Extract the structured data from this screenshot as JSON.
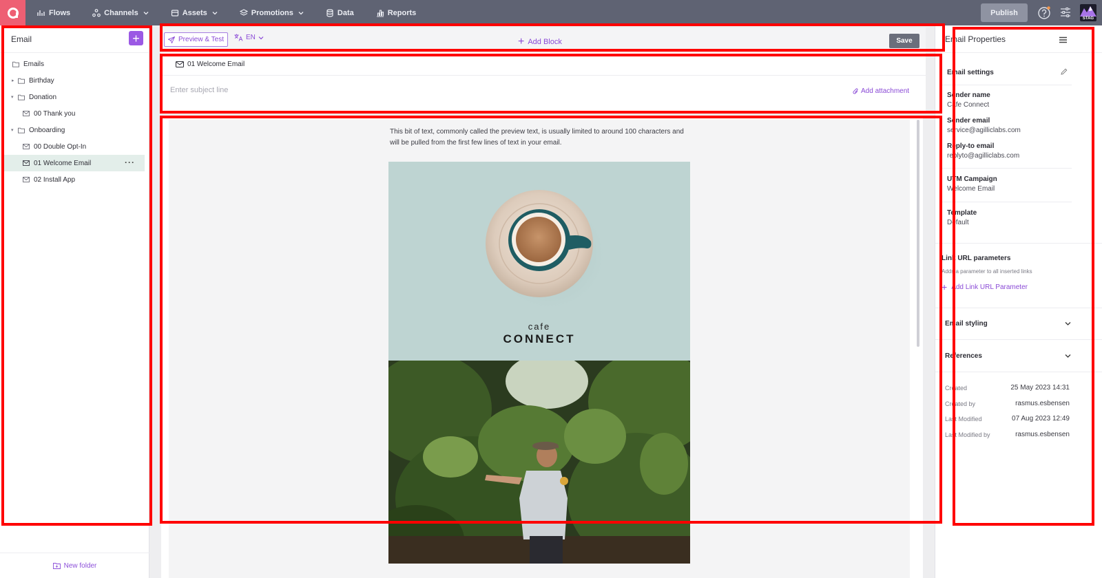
{
  "topbar": {
    "nav": [
      {
        "label": "Flows",
        "icon": "flows-icon",
        "dropdown": false
      },
      {
        "label": "Channels",
        "icon": "channels-icon",
        "dropdown": true
      },
      {
        "label": "Assets",
        "icon": "assets-icon",
        "dropdown": true
      },
      {
        "label": "Promotions",
        "icon": "promotions-icon",
        "dropdown": true
      },
      {
        "label": "Data",
        "icon": "data-icon",
        "dropdown": false
      },
      {
        "label": "Reports",
        "icon": "reports-icon",
        "dropdown": false
      }
    ],
    "publish_label": "Publish",
    "env_badge": "STAG"
  },
  "left_panel": {
    "title": "Email",
    "tree": [
      {
        "label": "Emails",
        "type": "folder",
        "level": 0,
        "expandable": false
      },
      {
        "label": "Birthday",
        "type": "folder",
        "level": 0,
        "expandable": true,
        "expanded": false
      },
      {
        "label": "Donation",
        "type": "folder",
        "level": 0,
        "expandable": true,
        "expanded": true
      },
      {
        "label": "00 Thank you",
        "type": "email",
        "level": 1
      },
      {
        "label": "Onboarding",
        "type": "folder",
        "level": 0,
        "expandable": true,
        "expanded": true
      },
      {
        "label": "00 Double Opt-In",
        "type": "email",
        "level": 1
      },
      {
        "label": "01 Welcome Email",
        "type": "email",
        "level": 1,
        "selected": true
      },
      {
        "label": "02 Install App",
        "type": "email",
        "level": 1
      }
    ],
    "new_folder_label": "New folder"
  },
  "toolbar": {
    "preview_label": "Preview & Test",
    "language": "EN",
    "add_block_label": "Add Block",
    "save_label": "Save"
  },
  "subject": {
    "email_name": "01 Welcome Email",
    "subject_placeholder": "Enter subject line",
    "attachment_label": "Add attachment"
  },
  "canvas": {
    "preheader": "This bit of text, commonly called the preview text, is usually limited to around 100 characters and will be pulled from the first few lines of text in your email.",
    "brand_small": "cafe",
    "brand_big": "CONNECT"
  },
  "properties": {
    "title": "Email Properties",
    "settings_label": "Email settings",
    "sender_name_label": "Sender name",
    "sender_name": "Cafe Connect",
    "sender_email_label": "Sender email",
    "sender_email": "service@agilliclabs.com",
    "reply_to_label": "Reply-to email",
    "reply_to": "replyto@agilliclabs.com",
    "utm_label": "UTM Campaign",
    "utm": "Welcome Email",
    "template_label": "Template",
    "template": "Default",
    "link_params_title": "Link URL parameters",
    "link_params_desc": "Adds a parameter to all inserted links",
    "add_link_param_label": "Add Link URL Parameter",
    "styling_label": "Email styling",
    "references_label": "References",
    "meta": [
      {
        "label": "Created",
        "value": "25 May 2023 14:31"
      },
      {
        "label": "Created by",
        "value": "rasmus.esbensen"
      },
      {
        "label": "Last Modified",
        "value": "07 Aug 2023 12:49"
      },
      {
        "label": "Last Modified by",
        "value": "rasmus.esbensen"
      }
    ]
  },
  "colors": {
    "topbar": "#5f6373",
    "logo": "#ee5f73",
    "accent": "#8a4ad6",
    "selected_row": "#e3eeea",
    "annotation": "#ff0000"
  }
}
